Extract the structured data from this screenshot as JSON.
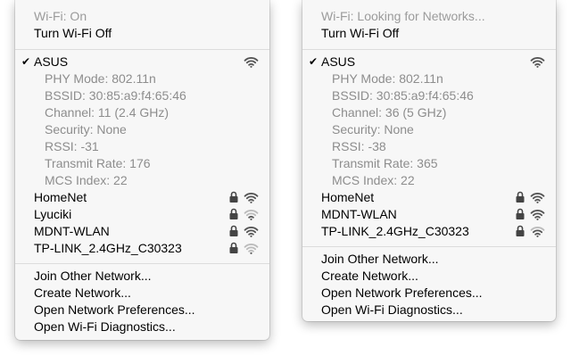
{
  "left_menu": {
    "status": "Wi-Fi: On",
    "toggle": "Turn Wi-Fi Off",
    "current_network": {
      "name": "ASUS",
      "details": [
        "PHY Mode: 802.11n",
        "BSSID: 30:85:a9:f4:65:46",
        "Channel: 11 (2.4 GHz)",
        "Security: None",
        "RSSI: -31",
        "Transmit Rate: 176",
        "MCS Index: 22"
      ]
    },
    "networks": [
      {
        "name": "HomeNet",
        "signal": "full"
      },
      {
        "name": "Lyuciki",
        "signal": "weak"
      },
      {
        "name": "MDNT-WLAN",
        "signal": "full"
      },
      {
        "name": "TP-LINK_2.4GHz_C30323",
        "signal": "weak"
      }
    ],
    "actions": [
      "Join Other Network...",
      "Create Network...",
      "Open Network Preferences...",
      "Open Wi-Fi Diagnostics..."
    ]
  },
  "right_menu": {
    "status": "Wi-Fi: Looking for Networks...",
    "toggle": "Turn Wi-Fi Off",
    "current_network": {
      "name": "ASUS",
      "details": [
        "PHY Mode: 802.11n",
        "BSSID: 30:85:a9:f4:65:46",
        "Channel: 36 (5 GHz)",
        "Security: None",
        "RSSI: -38",
        "Transmit Rate: 365",
        "MCS Index: 22"
      ]
    },
    "networks": [
      {
        "name": "HomeNet",
        "signal": "full"
      },
      {
        "name": "MDNT-WLAN",
        "signal": "full"
      },
      {
        "name": "TP-LINK_2.4GHz_C30323",
        "signal": "weak"
      }
    ],
    "actions": [
      "Join Other Network...",
      "Create Network...",
      "Open Network Preferences...",
      "Open Wi-Fi Diagnostics..."
    ]
  },
  "colors": {
    "menu_bg": "#f7f7f7",
    "disabled_text": "#9b9b9b",
    "icon_full": "#555555",
    "icon_weak": "#b5b5b5"
  }
}
